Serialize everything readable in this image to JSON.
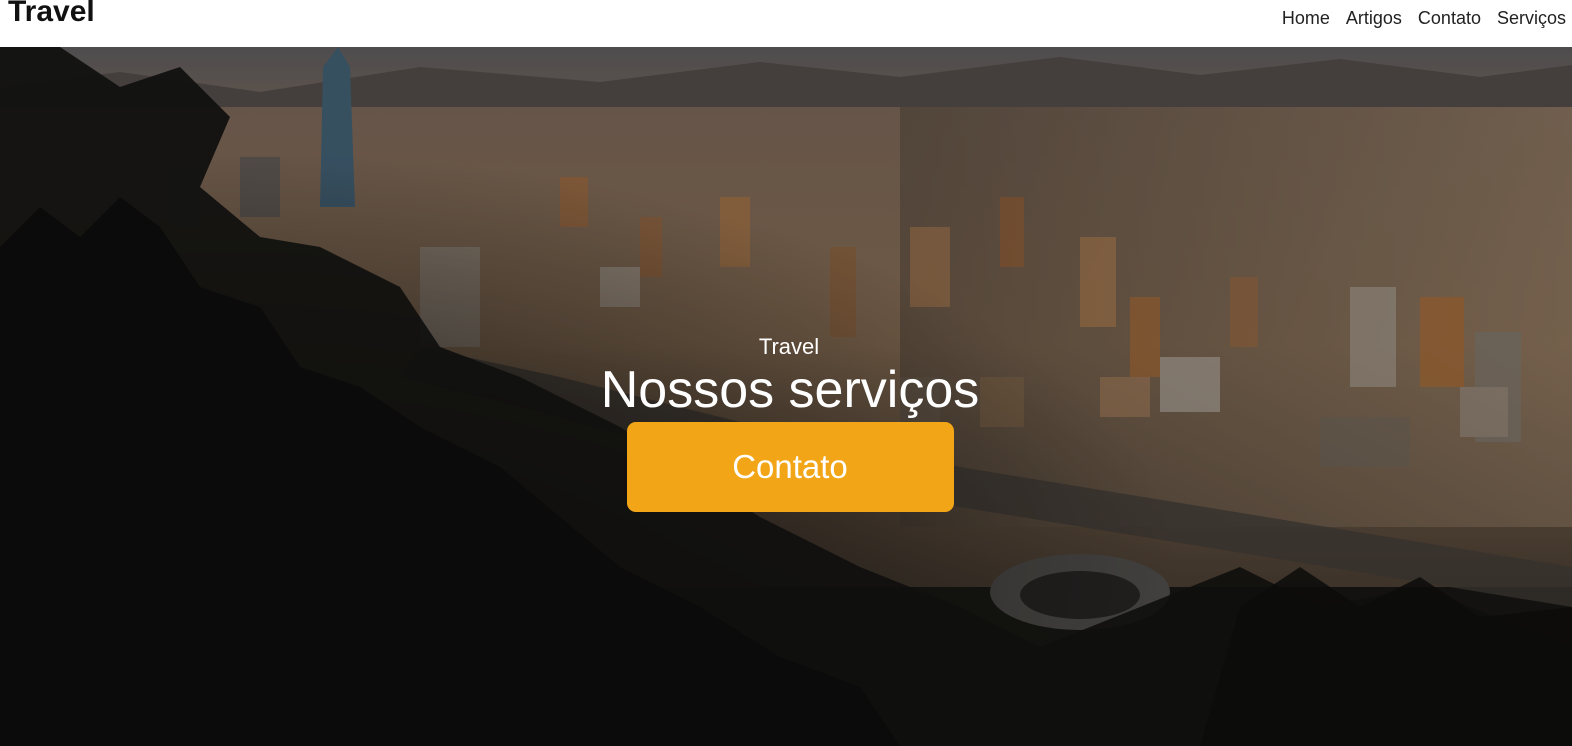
{
  "header": {
    "brand": "Travel",
    "nav": [
      {
        "label": "Home"
      },
      {
        "label": "Artigos"
      },
      {
        "label": "Contato"
      },
      {
        "label": "Serviços"
      }
    ]
  },
  "hero": {
    "kicker": "Travel",
    "title": "Nossos serviços",
    "cta_label": "Contato",
    "cta_color": "#f2a516",
    "background_image": "city-skyline-photo"
  }
}
